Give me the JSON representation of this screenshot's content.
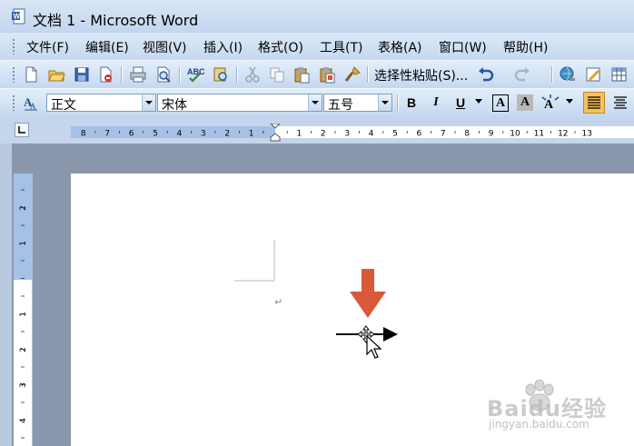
{
  "window": {
    "title": "文档 1 - Microsoft Word"
  },
  "menu": [
    "文件(F)",
    "编辑(E)",
    "视图(V)",
    "插入(I)",
    "格式(O)",
    "工具(T)",
    "表格(A)",
    "窗口(W)",
    "帮助(H)"
  ],
  "toolbar": {
    "paste_special_label": "选择性粘贴(S)..."
  },
  "format": {
    "style": "正文",
    "font": "宋体",
    "size": "五号",
    "bold": "B",
    "italic": "I",
    "underline": "U",
    "char_border": "A",
    "char_shading": "A"
  },
  "hruler": {
    "left_labels": [
      "8",
      "7",
      "6",
      "5",
      "4",
      "3",
      "2",
      "1"
    ],
    "right_labels": [
      "1",
      "2",
      "3",
      "4",
      "5",
      "6",
      "7",
      "8",
      "9",
      "10",
      "11",
      "12",
      "13"
    ]
  },
  "vruler": {
    "labels": [
      "2",
      "1",
      "1",
      "2",
      "3",
      "4"
    ]
  },
  "document": {
    "paragraph_mark": "↵"
  },
  "watermark": {
    "brand": "Baidu经验",
    "url": "jingyan.baidu.com"
  },
  "colors": {
    "annotation_arrow": "#d9583a",
    "page": "#ffffff",
    "workspace": "#8a97ad"
  }
}
